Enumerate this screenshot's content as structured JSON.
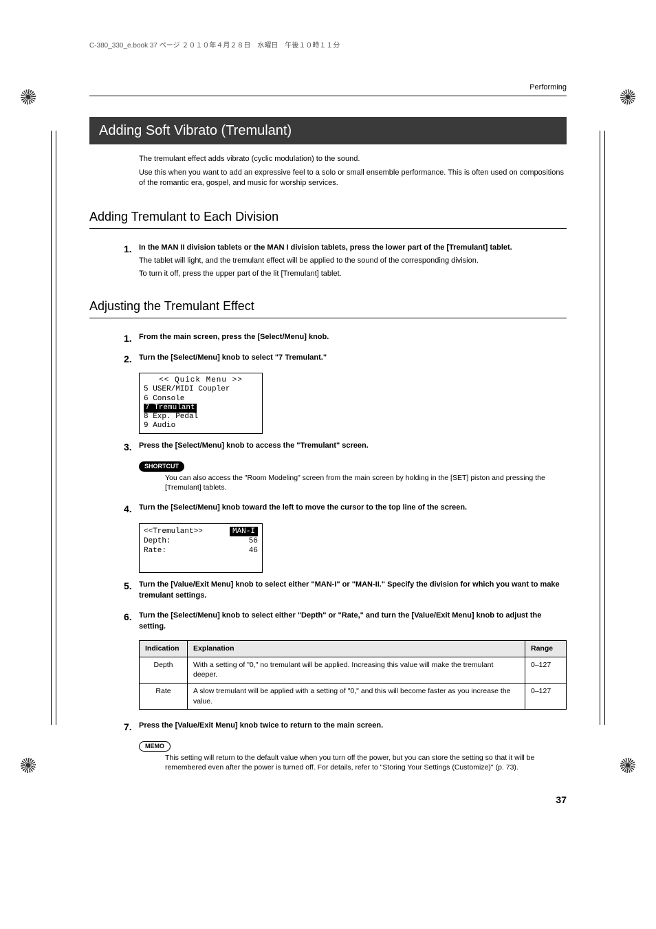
{
  "filestamp": "C-380_330_e.book  37 ページ  ２０１０年４月２８日　水曜日　午後１０時１１分",
  "section_header": "Performing",
  "h1": "Adding Soft Vibrato (Tremulant)",
  "intro": {
    "p1": "The tremulant effect adds vibrato (cyclic modulation) to the sound.",
    "p2": "Use this when you want to add an expressive feel to a solo or small ensemble performance. This is often used on compositions of the romantic era, gospel, and music for worship services."
  },
  "sub1": {
    "title": "Adding Tremulant to Each Division",
    "steps": [
      {
        "num": "1.",
        "title": "In the MAN II division tablets or the MAN I division tablets, press the lower part of the [Tremulant] tablet.",
        "lines": [
          "The tablet will light, and the tremulant effect will be applied to the sound of the corresponding division.",
          "To turn it off, press the upper part of the lit [Tremulant] tablet."
        ]
      }
    ]
  },
  "sub2": {
    "title": "Adjusting the Tremulant Effect",
    "step1": {
      "num": "1.",
      "title": "From the main screen, press the [Select/Menu] knob."
    },
    "step2": {
      "num": "2.",
      "title": "Turn the [Select/Menu] knob to select \"7 Tremulant.\""
    },
    "lcd1": {
      "title": "<< Quick Menu >>",
      "l1": "5 USER/MIDI Coupler",
      "l2": "6 Console",
      "l3": "7 Tremulant",
      "l4": "8 Exp. Pedal",
      "l5": "9 Audio"
    },
    "step3": {
      "num": "3.",
      "title": "Press the [Select/Menu] knob to access the \"Tremulant\" screen.",
      "shortcut_label": "SHORTCUT",
      "shortcut_text": "You can also access the \"Room Modeling\" screen from the main screen by holding in the [SET] piston and pressing the [Tremulant] tablets."
    },
    "step4": {
      "num": "4.",
      "title": "Turn the [Select/Menu] knob toward the left to move the cursor to the top line of the screen."
    },
    "lcd2": {
      "left_title": "<<Tremulant>>",
      "right_title": "MAN-I",
      "r1l": "Depth:",
      "r1v": "56",
      "r2l": "Rate:",
      "r2v": "46"
    },
    "step5": {
      "num": "5.",
      "title": "Turn the [Value/Exit Menu] knob to select either \"MAN-I\" or \"MAN-II.\" Specify the division for which you want to make tremulant settings."
    },
    "step6": {
      "num": "6.",
      "title": "Turn the [Select/Menu] knob to select either \"Depth\" or \"Rate,\" and turn the [Value/Exit Menu] knob to adjust the setting."
    },
    "table": {
      "h1": "Indication",
      "h2": "Explanation",
      "h3": "Range",
      "rows": [
        {
          "c1": "Depth",
          "c2": "With a setting of \"0,\" no tremulant will be applied. Increasing this value will make the tremulant deeper.",
          "c3": "0–127"
        },
        {
          "c1": "Rate",
          "c2": "A slow tremulant will be applied with a setting of \"0,\" and this will become faster as you increase the value.",
          "c3": "0–127"
        }
      ]
    },
    "step7": {
      "num": "7.",
      "title": "Press the [Value/Exit Menu] knob twice to return to the main screen.",
      "memo_label": "MEMO",
      "memo_text": "This setting will return to the default value when you turn off the power, but you can store the setting so that it will be remembered even after the power is turned off. For details, refer to  \"Storing Your Settings (Customize)\" (p. 73)."
    }
  },
  "page_number": "37"
}
